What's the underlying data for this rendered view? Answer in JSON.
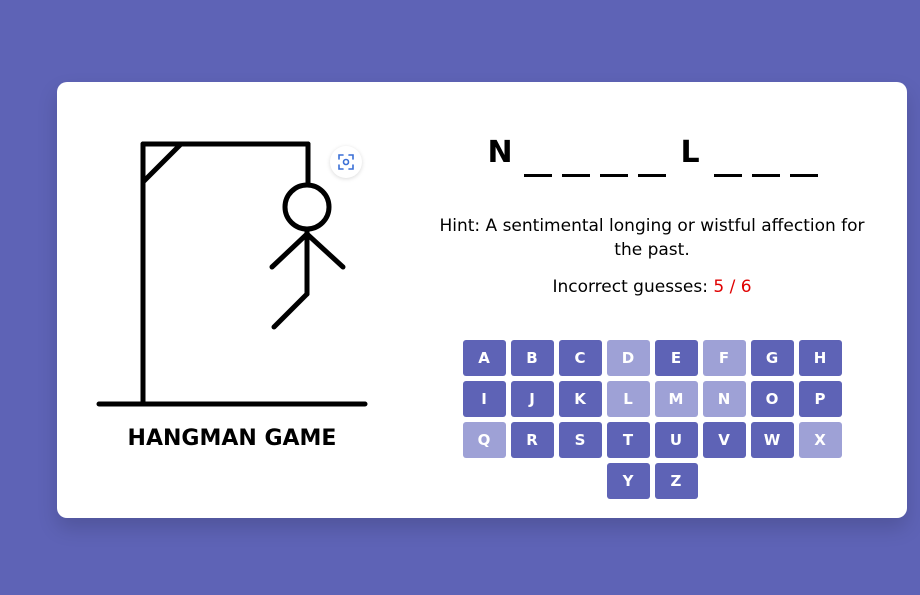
{
  "game": {
    "title": "HANGMAN GAME",
    "word_slots": [
      "N",
      "",
      "",
      "",
      "",
      "L",
      "",
      "",
      ""
    ],
    "hint_label": "Hint:",
    "hint_text": "A sentimental longing or wistful affection for the past.",
    "guesses_label": "Incorrect guesses:",
    "guesses_count": "5 / 6",
    "incorrect_max": 6,
    "incorrect_count": 5
  },
  "keyboard": {
    "keys": [
      {
        "letter": "A",
        "used": false
      },
      {
        "letter": "B",
        "used": false
      },
      {
        "letter": "C",
        "used": false
      },
      {
        "letter": "D",
        "used": true
      },
      {
        "letter": "E",
        "used": false
      },
      {
        "letter": "F",
        "used": true
      },
      {
        "letter": "G",
        "used": false
      },
      {
        "letter": "H",
        "used": false
      },
      {
        "letter": "I",
        "used": false
      },
      {
        "letter": "J",
        "used": false
      },
      {
        "letter": "K",
        "used": false
      },
      {
        "letter": "L",
        "used": true
      },
      {
        "letter": "M",
        "used": true
      },
      {
        "letter": "N",
        "used": true
      },
      {
        "letter": "O",
        "used": false
      },
      {
        "letter": "P",
        "used": false
      },
      {
        "letter": "Q",
        "used": true
      },
      {
        "letter": "R",
        "used": false
      },
      {
        "letter": "S",
        "used": false
      },
      {
        "letter": "T",
        "used": false
      },
      {
        "letter": "U",
        "used": false
      },
      {
        "letter": "V",
        "used": false
      },
      {
        "letter": "W",
        "used": false
      },
      {
        "letter": "X",
        "used": true
      },
      {
        "letter": "Y",
        "used": false
      },
      {
        "letter": "Z",
        "used": false
      }
    ]
  },
  "colors": {
    "background": "#5e63b6",
    "key_active": "#5e63b6",
    "key_used": "#9ea1d6",
    "guess_count": "#e00000"
  },
  "icons": {
    "overlay": "screen-capture-icon"
  }
}
